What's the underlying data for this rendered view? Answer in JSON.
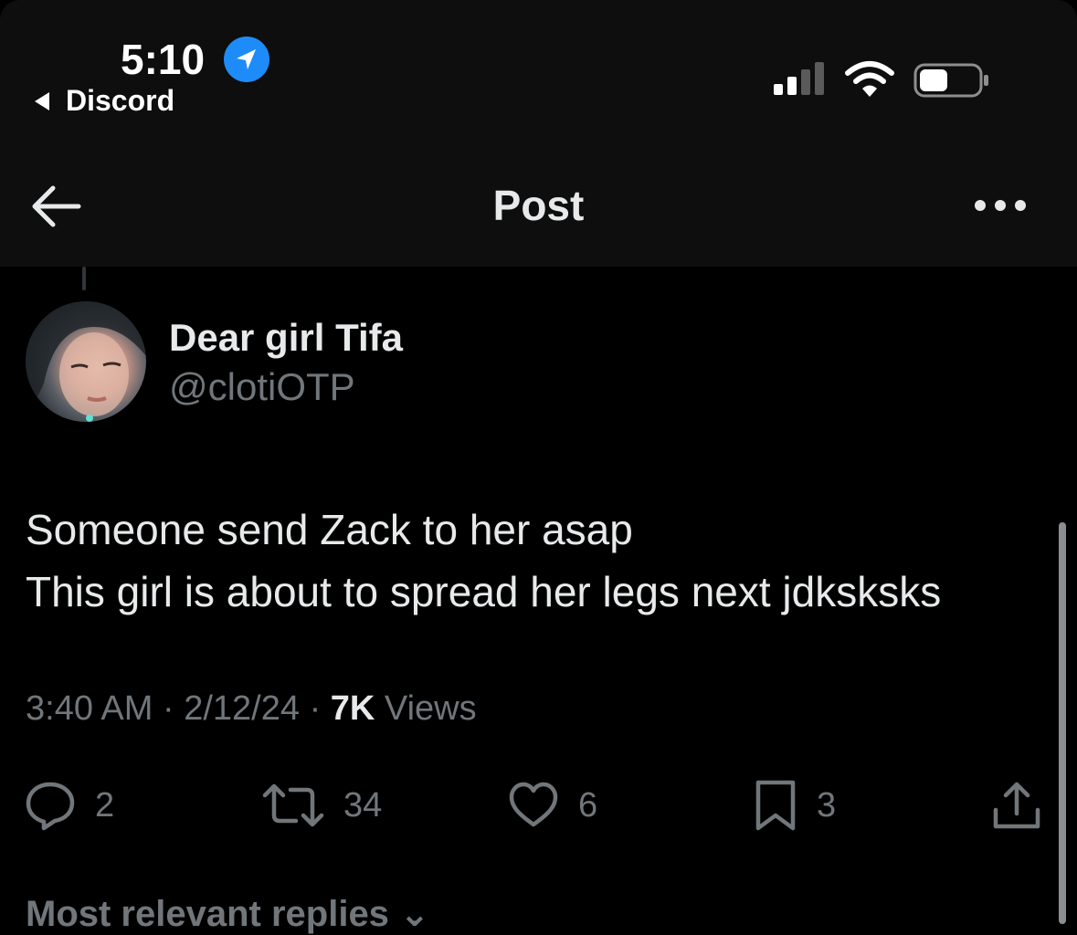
{
  "status_bar": {
    "time": "5:10",
    "back_app_label": "Discord",
    "location_icon": "location-arrow-icon",
    "signal_icon": "cellular-signal-icon",
    "wifi_icon": "wifi-icon",
    "battery_icon": "battery-icon"
  },
  "nav": {
    "title": "Post",
    "back_icon": "arrow-left-icon",
    "more_icon": "more-horizontal-icon"
  },
  "post": {
    "author": {
      "display_name": "Dear girl Tifa",
      "handle": "@clotiOTP"
    },
    "text_lines": [
      "Someone send Zack to her asap",
      "This girl is about to spread her legs next jdksksks"
    ],
    "meta": {
      "time": "3:40 AM",
      "separator": "·",
      "date": "2/12/24",
      "views_count": "7K",
      "views_label": "Views"
    },
    "actions": {
      "reply": {
        "icon": "reply-icon",
        "count": "2"
      },
      "repost": {
        "icon": "repost-icon",
        "count": "34"
      },
      "like": {
        "icon": "heart-icon",
        "count": "6"
      },
      "bookmark": {
        "icon": "bookmark-icon",
        "count": "3"
      },
      "share": {
        "icon": "share-icon"
      }
    }
  },
  "replies_header": "Most relevant replies",
  "colors": {
    "background": "#000000",
    "header_background": "#0e0e0e",
    "primary_text": "#e7e9ea",
    "secondary_text": "#71767b",
    "accent_blue": "#1d8cf8"
  }
}
